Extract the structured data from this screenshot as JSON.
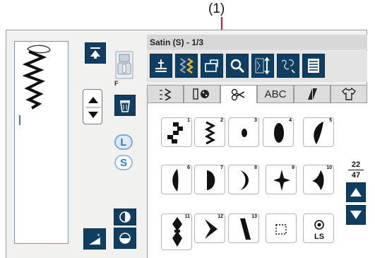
{
  "callout": {
    "label": "(1)"
  },
  "title_bar": {
    "text": "Satin (S) - 1/3"
  },
  "foot": {
    "label": "F"
  },
  "length_mode": {
    "long": "L",
    "short": "S"
  },
  "tabs": [
    {
      "name": "utility",
      "label": "",
      "active": false
    },
    {
      "name": "buttonhole",
      "label": "",
      "active": false
    },
    {
      "name": "satin",
      "label": "",
      "active": true
    },
    {
      "name": "alphabet",
      "label": "ABC",
      "active": false
    },
    {
      "name": "quilt",
      "label": "",
      "active": false
    },
    {
      "name": "garment",
      "label": "",
      "active": false
    }
  ],
  "toolbar_icons": [
    "stitch-settings-icon",
    "mirror-icon",
    "memory-icon",
    "search-icon",
    "width-length-icon",
    "pattern-edit-icon",
    "list-icon"
  ],
  "stitches": [
    {
      "num": "1",
      "icon": "checker-stitch-icon"
    },
    {
      "num": "2",
      "icon": "zigzag-stitch-icon"
    },
    {
      "num": "3",
      "icon": "dot-stitch-icon"
    },
    {
      "num": "4",
      "icon": "oval-stitch-icon"
    },
    {
      "num": "5",
      "icon": "leaf-stitch-icon"
    },
    {
      "num": "6",
      "icon": "left-leaf-stitch-icon"
    },
    {
      "num": "7",
      "icon": "half-moon-stitch-icon"
    },
    {
      "num": "8",
      "icon": "crescent-stitch-icon"
    },
    {
      "num": "9",
      "icon": "star-stitch-icon"
    },
    {
      "num": "10",
      "icon": "crescent-leaf-stitch-icon"
    },
    {
      "num": "11",
      "icon": "diamond-chain-stitch-icon"
    },
    {
      "num": "12",
      "icon": "chevron-stitch-icon"
    },
    {
      "num": "13",
      "icon": "slant-bar-stitch-icon"
    },
    {
      "num": "",
      "icon": "empty-box-icon"
    },
    {
      "num": "",
      "icon": "ls-icon",
      "label": "LS"
    }
  ],
  "page": {
    "current": "22",
    "total": "47"
  }
}
